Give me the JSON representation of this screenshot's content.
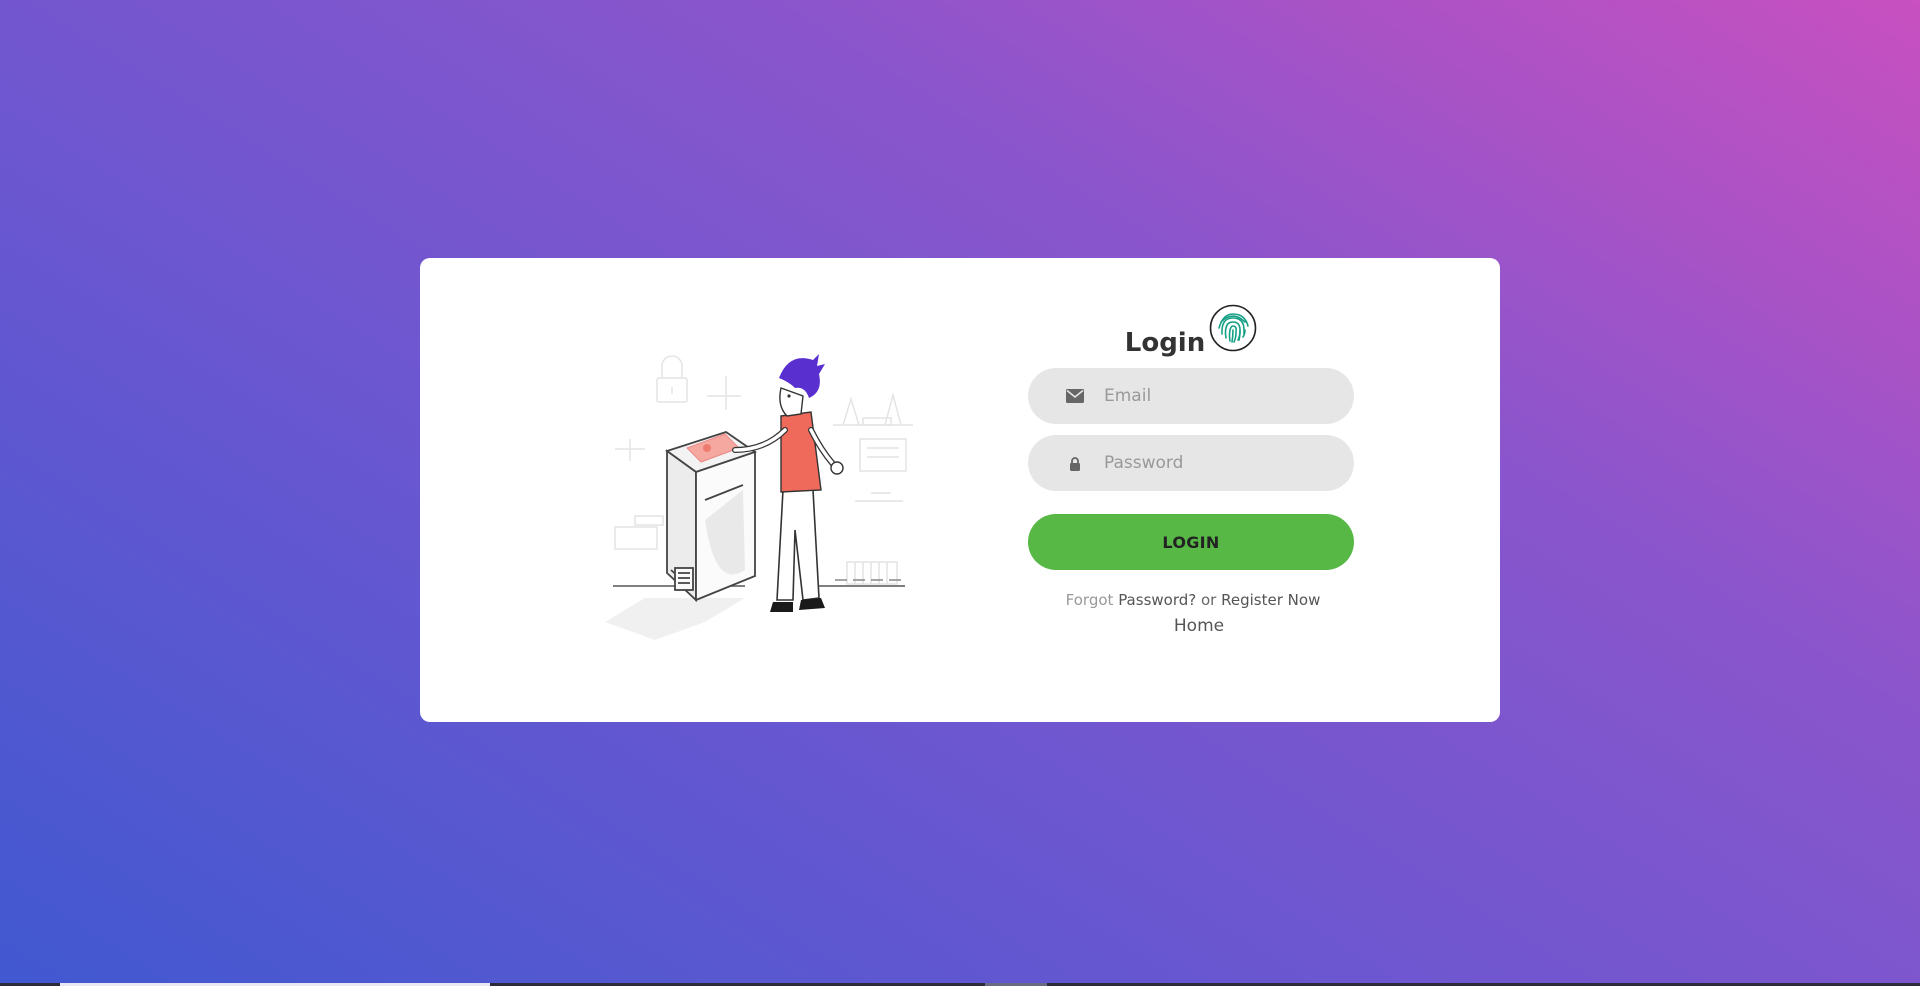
{
  "form": {
    "title": "Login",
    "title_icon": "fingerprint-icon",
    "email": {
      "placeholder": "Email",
      "value": "",
      "icon": "envelope-icon"
    },
    "password": {
      "placeholder": "Password",
      "value": "",
      "icon": "lock-icon"
    },
    "login_button_label": "LOGIN",
    "forgot_prefix": "Forgot",
    "forgot_link": "Password?",
    "or_text": "or",
    "register_link": "Register Now",
    "home_link": "Home"
  },
  "illustration": {
    "name": "fingerprint-scanner-illustration"
  },
  "colors": {
    "background_gradient": [
      "#c850c0",
      "#4158d0"
    ],
    "button": "#57b846",
    "field": "#e6e6e6",
    "card": "#ffffff",
    "fingerprint": "#16a085"
  }
}
